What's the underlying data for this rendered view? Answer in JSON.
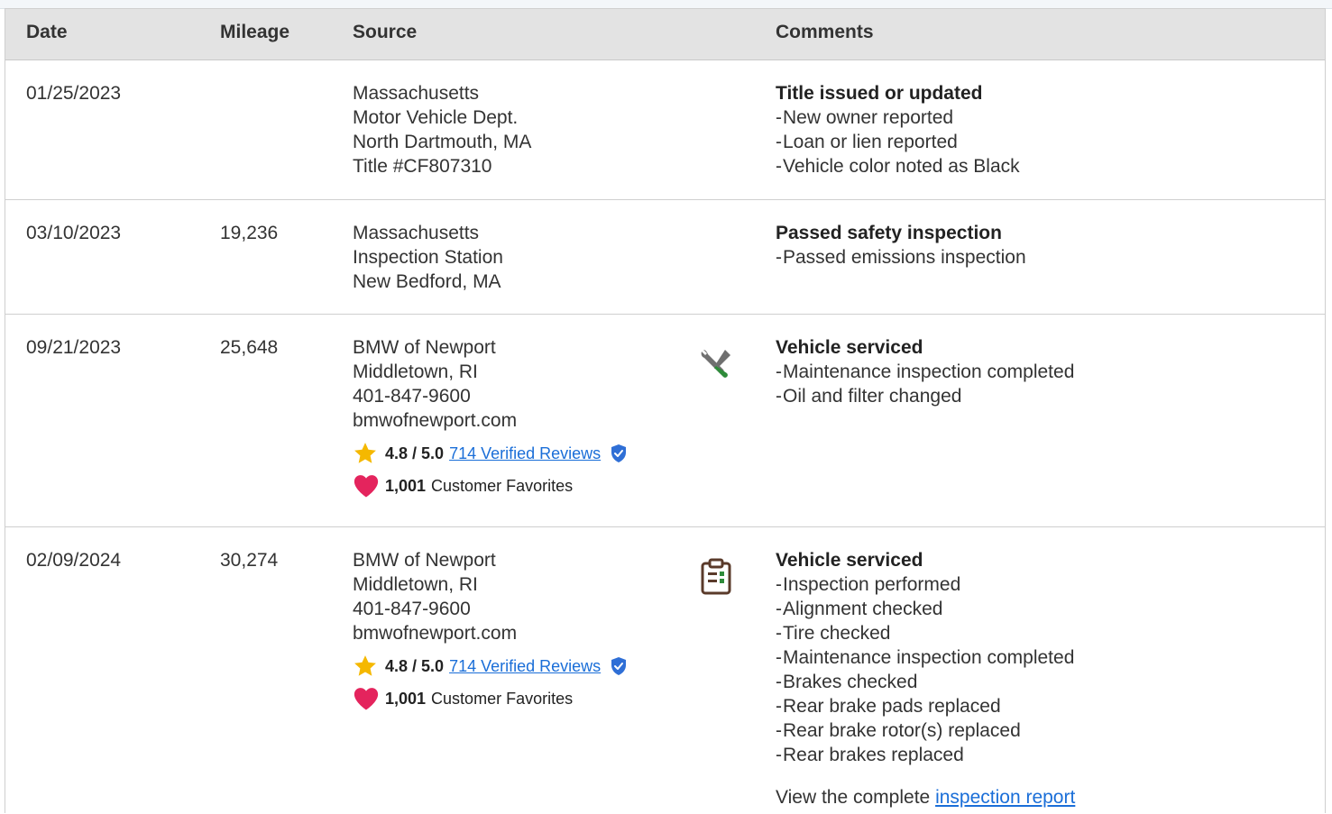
{
  "header": {
    "date": "Date",
    "mileage": "Mileage",
    "source": "Source",
    "comments": "Comments"
  },
  "records": [
    {
      "date": "01/25/2023",
      "mileage": "",
      "source": [
        "Massachusetts",
        "Motor Vehicle Dept.",
        "North Dartmouth, MA",
        "Title #CF807310"
      ],
      "comment_title": "Title issued or updated",
      "comment_items": [
        "New owner reported",
        "Loan or lien reported",
        "Vehicle color noted as Black"
      ]
    },
    {
      "date": "03/10/2023",
      "mileage": "19,236",
      "source": [
        "Massachusetts",
        "Inspection Station",
        "New Bedford, MA"
      ],
      "comment_title": "Passed safety inspection",
      "comment_items": [
        "Passed emissions inspection"
      ]
    },
    {
      "date": "09/21/2023",
      "mileage": "25,648",
      "source": [
        "BMW of Newport",
        "Middletown, RI",
        "401-847-9600",
        "bmwofnewport.com"
      ],
      "rating": "4.8 / 5.0",
      "reviews_link": "714 Verified Reviews",
      "favorites_count": "1,001",
      "favorites_label": "Customer Favorites",
      "type_icon": "wrench-screwdriver-icon",
      "comment_title": "Vehicle serviced",
      "comment_items": [
        "Maintenance inspection completed",
        "Oil and filter changed"
      ]
    },
    {
      "date": "02/09/2024",
      "mileage": "30,274",
      "source": [
        "BMW of Newport",
        "Middletown, RI",
        "401-847-9600",
        "bmwofnewport.com"
      ],
      "rating": "4.8 / 5.0",
      "reviews_link": "714 Verified Reviews",
      "favorites_count": "1,001",
      "favorites_label": "Customer Favorites",
      "type_icon": "clipboard-icon",
      "comment_title": "Vehicle serviced",
      "comment_items": [
        "Inspection performed",
        "Alignment checked",
        "Tire checked",
        "Maintenance inspection completed",
        "Brakes checked",
        "Rear brake pads replaced",
        "Rear brake rotor(s) replaced",
        "Rear brakes replaced"
      ],
      "view_text": "View the complete",
      "view_link": "inspection report"
    }
  ],
  "colors": {
    "link": "#1a6ed8",
    "star": "#f5b800",
    "heart": "#e4245d",
    "verified": "#2f6fd6",
    "header_bg": "#e3e3e3",
    "wrench_gray": "#6f6f6f",
    "screwdriver_green": "#2e8b3a",
    "clipboard_brown": "#5a3a2a"
  }
}
